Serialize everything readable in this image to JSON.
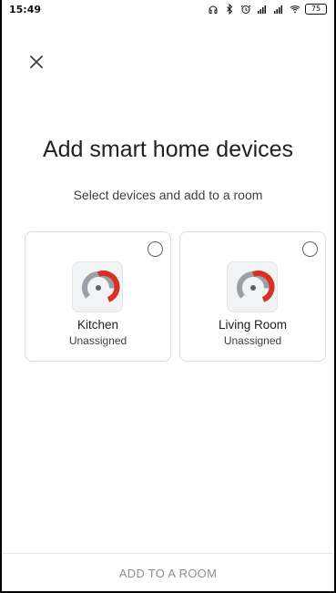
{
  "status_bar": {
    "time": "15:49",
    "icons": [
      "headphones-icon",
      "bluetooth-icon",
      "alarm-icon",
      "signal-icon",
      "signal-icon-2",
      "wifi-icon"
    ],
    "battery": "75"
  },
  "close_label": "×",
  "title": "Add smart home devices",
  "subtitle": "Select devices and add to a room",
  "devices": [
    {
      "name": "Kitchen",
      "status": "Unassigned",
      "selected": false
    },
    {
      "name": "Living Room",
      "status": "Unassigned",
      "selected": false
    }
  ],
  "footer": {
    "button_label": "ADD TO A ROOM"
  },
  "colors": {
    "text": "#202124",
    "muted": "#8a8f95",
    "accent": "#d93025",
    "border": "#dadce0"
  }
}
